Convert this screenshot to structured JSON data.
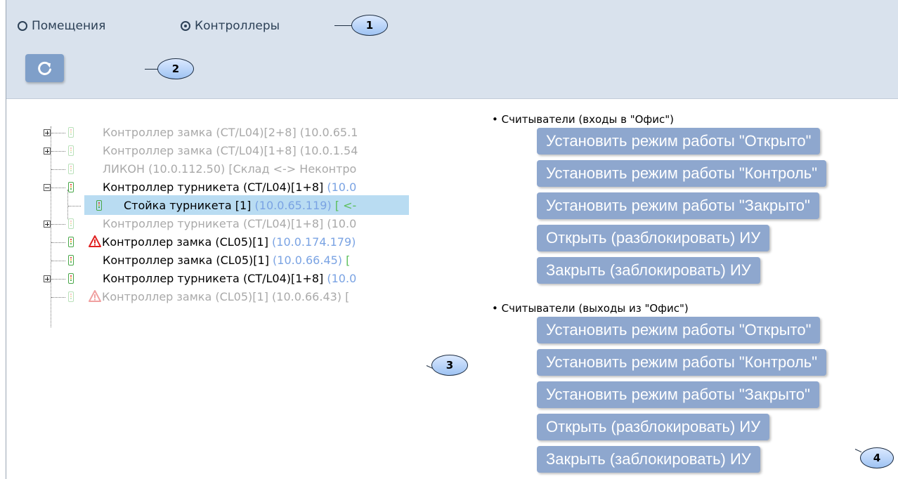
{
  "view_mode": {
    "options": [
      {
        "label": "Помещения",
        "selected": false
      },
      {
        "label": "Контроллеры",
        "selected": true
      }
    ]
  },
  "toolbar": {
    "refresh_icon": "refresh-icon"
  },
  "callouts": [
    "1",
    "2",
    "3",
    "4"
  ],
  "tree": [
    {
      "expander": "plus",
      "active": false,
      "warn": false,
      "name": "Контроллер замка (CT/L04)[2+8]",
      "ip": "(10.0.65.1",
      "extra": ""
    },
    {
      "expander": "plus",
      "active": false,
      "warn": false,
      "name": "Контроллер замка (CT/L04)[1+8]",
      "ip": "(10.0.1.54",
      "extra": ""
    },
    {
      "expander": "none",
      "active": false,
      "warn": false,
      "name": "ЛИКОН",
      "ip": "(10.0.112.50)",
      "extra": "[Склад <-> Неконтро"
    },
    {
      "expander": "minus",
      "active": true,
      "warn": false,
      "name": "Контроллер турникета (CT/L04)[1+8]",
      "ip": "(10.0",
      "extra": ""
    },
    {
      "expander": "child",
      "active": true,
      "warn": false,
      "selected": true,
      "name": "Стойка турникета [1]",
      "ip": "(10.0.65.119)",
      "extra": "[ <-"
    },
    {
      "expander": "plus",
      "active": false,
      "warn": false,
      "name": "Контроллер турникета (CT/L04)[1+8]",
      "ip": "(10.0",
      "extra": ""
    },
    {
      "expander": "none",
      "active": true,
      "warn": true,
      "name": "Контроллер замка (CL05)[1]",
      "ip": "(10.0.174.179)",
      "extra": ""
    },
    {
      "expander": "none",
      "active": true,
      "warn": false,
      "name": "Контроллер замка (CL05)[1]",
      "ip": "(10.0.66.45)",
      "extra": "["
    },
    {
      "expander": "plus",
      "active": true,
      "warn": false,
      "name": "Контроллер турникета (CT/L04)[1+8]",
      "ip": "(10.0",
      "extra": ""
    },
    {
      "expander": "none",
      "active": false,
      "warn": true,
      "name": "Контроллер замка (CL05)[1]",
      "ip": "(10.0.66.43)",
      "extra": "["
    }
  ],
  "sections": [
    {
      "title": "Считыватели (входы в \"Офис\")",
      "buttons": [
        "Установить режим работы \"Открыто\"",
        "Установить режим работы \"Контроль\"",
        "Установить режим работы \"Закрыто\"",
        "Открыть (разблокировать) ИУ",
        "Закрыть (заблокировать) ИУ"
      ]
    },
    {
      "title": "Считыватели (выходы из \"Офис\")",
      "buttons": [
        "Установить режим работы \"Открыто\"",
        "Установить режим работы \"Контроль\"",
        "Установить режим работы \"Закрыто\"",
        "Открыть (разблокировать) ИУ",
        "Закрыть (заблокировать) ИУ"
      ]
    }
  ],
  "colors": {
    "topbar": "#d9e2ed",
    "button": "#8ea7ce",
    "selection": "#b9dcf2",
    "ip": "#7aa3e3",
    "warning": "#e02020"
  }
}
